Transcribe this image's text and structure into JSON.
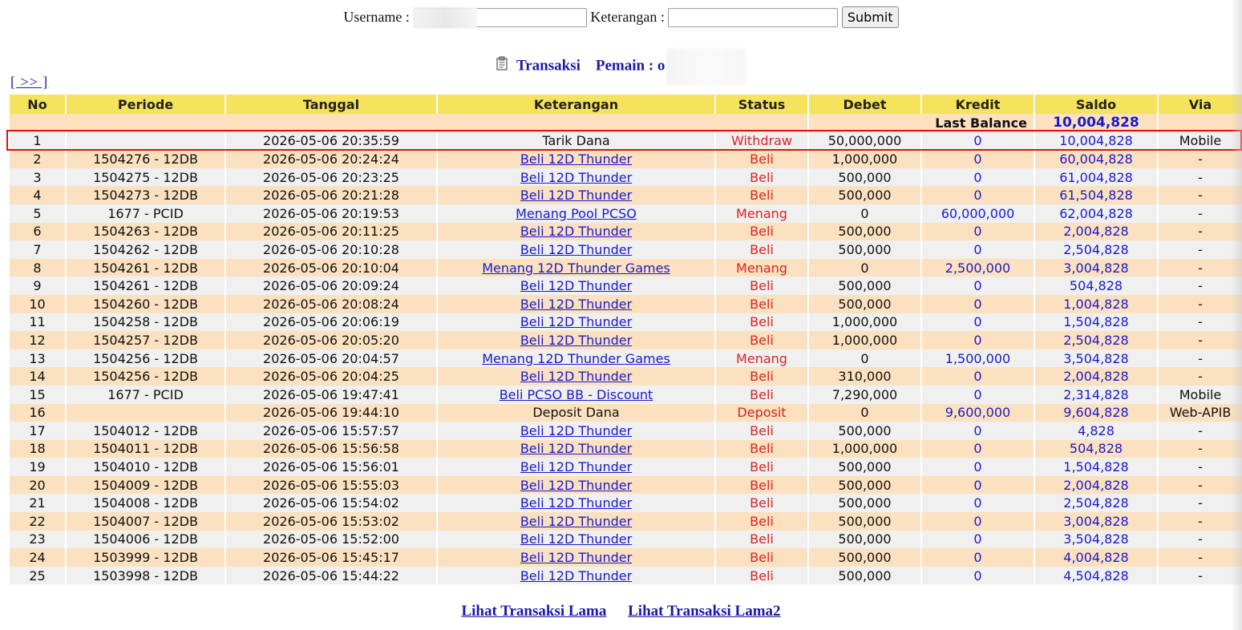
{
  "search": {
    "username_label": "Username :",
    "username_value": "",
    "keterangan_label": "Keterangan :",
    "keterangan_value": "",
    "submit_label": "Submit"
  },
  "heading": {
    "transaksi_label": "Transaksi",
    "pemain_label": "Pemain : o"
  },
  "nav": {
    "next_label": "[ >> ]"
  },
  "table": {
    "columns": [
      "No",
      "Periode",
      "Tanggal",
      "Keterangan",
      "Status",
      "Debet",
      "Kredit",
      "Saldo",
      "Via"
    ],
    "last_balance_label": "Last Balance",
    "last_balance_value": "10,004,828",
    "rows": [
      {
        "no": "1",
        "periode": "",
        "tanggal": "2026-05-06 20:35:59",
        "keterangan": "Tarik Dana",
        "link": false,
        "status": "Withdraw",
        "debet": "50,000,000",
        "kredit": "0",
        "saldo": "10,004,828",
        "via": "Mobile"
      },
      {
        "no": "2",
        "periode": "1504276 - 12DB",
        "tanggal": "2026-05-06 20:24:24",
        "keterangan": "Beli 12D Thunder",
        "link": true,
        "status": "Beli",
        "debet": "1,000,000",
        "kredit": "0",
        "saldo": "60,004,828",
        "via": "-"
      },
      {
        "no": "3",
        "periode": "1504275 - 12DB",
        "tanggal": "2026-05-06 20:23:25",
        "keterangan": "Beli 12D Thunder",
        "link": true,
        "status": "Beli",
        "debet": "500,000",
        "kredit": "0",
        "saldo": "61,004,828",
        "via": "-"
      },
      {
        "no": "4",
        "periode": "1504273 - 12DB",
        "tanggal": "2026-05-06 20:21:28",
        "keterangan": "Beli 12D Thunder",
        "link": true,
        "status": "Beli",
        "debet": "500,000",
        "kredit": "0",
        "saldo": "61,504,828",
        "via": "-"
      },
      {
        "no": "5",
        "periode": "1677 - PCID",
        "tanggal": "2026-05-06 20:19:53",
        "keterangan": "Menang Pool PCSO",
        "link": true,
        "status": "Menang",
        "debet": "0",
        "kredit": "60,000,000",
        "saldo": "62,004,828",
        "via": "-"
      },
      {
        "no": "6",
        "periode": "1504263 - 12DB",
        "tanggal": "2026-05-06 20:11:25",
        "keterangan": "Beli 12D Thunder",
        "link": true,
        "status": "Beli",
        "debet": "500,000",
        "kredit": "0",
        "saldo": "2,004,828",
        "via": "-"
      },
      {
        "no": "7",
        "periode": "1504262 - 12DB",
        "tanggal": "2026-05-06 20:10:28",
        "keterangan": "Beli 12D Thunder",
        "link": true,
        "status": "Beli",
        "debet": "500,000",
        "kredit": "0",
        "saldo": "2,504,828",
        "via": "-"
      },
      {
        "no": "8",
        "periode": "1504261 - 12DB",
        "tanggal": "2026-05-06 20:10:04",
        "keterangan": "Menang 12D Thunder Games",
        "link": true,
        "status": "Menang",
        "debet": "0",
        "kredit": "2,500,000",
        "saldo": "3,004,828",
        "via": "-"
      },
      {
        "no": "9",
        "periode": "1504261 - 12DB",
        "tanggal": "2026-05-06 20:09:24",
        "keterangan": "Beli 12D Thunder",
        "link": true,
        "status": "Beli",
        "debet": "500,000",
        "kredit": "0",
        "saldo": "504,828",
        "via": "-"
      },
      {
        "no": "10",
        "periode": "1504260 - 12DB",
        "tanggal": "2026-05-06 20:08:24",
        "keterangan": "Beli 12D Thunder",
        "link": true,
        "status": "Beli",
        "debet": "500,000",
        "kredit": "0",
        "saldo": "1,004,828",
        "via": "-"
      },
      {
        "no": "11",
        "periode": "1504258 - 12DB",
        "tanggal": "2026-05-06 20:06:19",
        "keterangan": "Beli 12D Thunder",
        "link": true,
        "status": "Beli",
        "debet": "1,000,000",
        "kredit": "0",
        "saldo": "1,504,828",
        "via": "-"
      },
      {
        "no": "12",
        "periode": "1504257 - 12DB",
        "tanggal": "2026-05-06 20:05:20",
        "keterangan": "Beli 12D Thunder",
        "link": true,
        "status": "Beli",
        "debet": "1,000,000",
        "kredit": "0",
        "saldo": "2,504,828",
        "via": "-"
      },
      {
        "no": "13",
        "periode": "1504256 - 12DB",
        "tanggal": "2026-05-06 20:04:57",
        "keterangan": "Menang 12D Thunder Games",
        "link": true,
        "status": "Menang",
        "debet": "0",
        "kredit": "1,500,000",
        "saldo": "3,504,828",
        "via": "-"
      },
      {
        "no": "14",
        "periode": "1504256 - 12DB",
        "tanggal": "2026-05-06 20:04:25",
        "keterangan": "Beli 12D Thunder",
        "link": true,
        "status": "Beli",
        "debet": "310,000",
        "kredit": "0",
        "saldo": "2,004,828",
        "via": "-"
      },
      {
        "no": "15",
        "periode": "1677 - PCID",
        "tanggal": "2026-05-06 19:47:41",
        "keterangan": "Beli PCSO BB - Discount",
        "link": true,
        "status": "Beli",
        "debet": "7,290,000",
        "kredit": "0",
        "saldo": "2,314,828",
        "via": "Mobile"
      },
      {
        "no": "16",
        "periode": "",
        "tanggal": "2026-05-06 19:44:10",
        "keterangan": "Deposit Dana",
        "link": false,
        "status": "Deposit",
        "debet": "0",
        "kredit": "9,600,000",
        "saldo": "9,604,828",
        "via": "Web-APIB"
      },
      {
        "no": "17",
        "periode": "1504012 - 12DB",
        "tanggal": "2026-05-06 15:57:57",
        "keterangan": "Beli 12D Thunder",
        "link": true,
        "status": "Beli",
        "debet": "500,000",
        "kredit": "0",
        "saldo": "4,828",
        "via": "-"
      },
      {
        "no": "18",
        "periode": "1504011 - 12DB",
        "tanggal": "2026-05-06 15:56:58",
        "keterangan": "Beli 12D Thunder",
        "link": true,
        "status": "Beli",
        "debet": "1,000,000",
        "kredit": "0",
        "saldo": "504,828",
        "via": "-"
      },
      {
        "no": "19",
        "periode": "1504010 - 12DB",
        "tanggal": "2026-05-06 15:56:01",
        "keterangan": "Beli 12D Thunder",
        "link": true,
        "status": "Beli",
        "debet": "500,000",
        "kredit": "0",
        "saldo": "1,504,828",
        "via": "-"
      },
      {
        "no": "20",
        "periode": "1504009 - 12DB",
        "tanggal": "2026-05-06 15:55:03",
        "keterangan": "Beli 12D Thunder",
        "link": true,
        "status": "Beli",
        "debet": "500,000",
        "kredit": "0",
        "saldo": "2,004,828",
        "via": "-"
      },
      {
        "no": "21",
        "periode": "1504008 - 12DB",
        "tanggal": "2026-05-06 15:54:02",
        "keterangan": "Beli 12D Thunder",
        "link": true,
        "status": "Beli",
        "debet": "500,000",
        "kredit": "0",
        "saldo": "2,504,828",
        "via": "-"
      },
      {
        "no": "22",
        "periode": "1504007 - 12DB",
        "tanggal": "2026-05-06 15:53:02",
        "keterangan": "Beli 12D Thunder",
        "link": true,
        "status": "Beli",
        "debet": "500,000",
        "kredit": "0",
        "saldo": "3,004,828",
        "via": "-"
      },
      {
        "no": "23",
        "periode": "1504006 - 12DB",
        "tanggal": "2026-05-06 15:52:00",
        "keterangan": "Beli 12D Thunder",
        "link": true,
        "status": "Beli",
        "debet": "500,000",
        "kredit": "0",
        "saldo": "3,504,828",
        "via": "-"
      },
      {
        "no": "24",
        "periode": "1503999 - 12DB",
        "tanggal": "2026-05-06 15:45:17",
        "keterangan": "Beli 12D Thunder",
        "link": true,
        "status": "Beli",
        "debet": "500,000",
        "kredit": "0",
        "saldo": "4,004,828",
        "via": "-"
      },
      {
        "no": "25",
        "periode": "1503998 - 12DB",
        "tanggal": "2026-05-06 15:44:22",
        "keterangan": "Beli 12D Thunder",
        "link": true,
        "status": "Beli",
        "debet": "500,000",
        "kredit": "0",
        "saldo": "4,504,828",
        "via": "-"
      }
    ]
  },
  "footer": {
    "old_tx_label": "Lihat Transaksi Lama",
    "old_tx2_label": "Lihat Transaksi Lama2"
  },
  "colors": {
    "header_bg": "#f5e25d",
    "row_gray": "#f0f0f0",
    "row_peach": "#fbe1bf",
    "status_red": "#dd2222",
    "link_blue": "#1a1acc",
    "highlight_border": "#e01010"
  }
}
